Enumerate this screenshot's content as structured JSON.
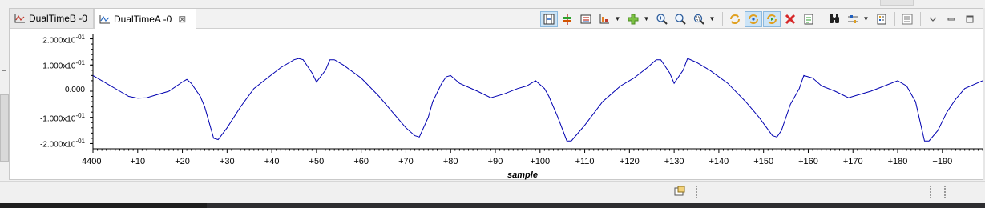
{
  "tabs": [
    {
      "label": "DualTimeB -0",
      "active": false
    },
    {
      "label": "DualTimeA -0",
      "active": true
    }
  ],
  "tab_close_glyph": "⊠",
  "toolbar_icons": [
    "align-cursors-icon",
    "add-marker-icon",
    "measure-icon",
    "display-properties-icon",
    "zoom-in-icon",
    "zoom-out-icon",
    "zoom-region-icon",
    "refresh-icon",
    "auto-refresh-icon",
    "continuous-refresh-icon",
    "clear-graph-icon",
    "export-icon",
    "pin-icon",
    "data-settings-icon",
    "graph-properties-icon",
    "view-menu-icon"
  ],
  "chart_data": {
    "type": "line",
    "xlabel": "sample",
    "x_start_label": "4400",
    "x_ticks": [
      "+10",
      "+20",
      "+30",
      "+40",
      "+50",
      "+60",
      "+70",
      "+80",
      "+90",
      "+100",
      "+110",
      "+120",
      "+130",
      "+140",
      "+150",
      "+160",
      "+170",
      "+180",
      "+190"
    ],
    "y_ticks": [
      {
        "mant": "2.000x10",
        "exp": "-01"
      },
      {
        "mant": "1.000x10",
        "exp": "-01"
      },
      {
        "mant": "0.000",
        "exp": ""
      },
      {
        "mant": "-1.000x10",
        "exp": "-01"
      },
      {
        "mant": "-2.000x10",
        "exp": "-01"
      }
    ],
    "ylim": [
      -0.22,
      0.22
    ],
    "xlim": [
      0,
      199
    ],
    "line_color": "#0000b0",
    "series": [
      {
        "values": [
          [
            0,
            0.06
          ],
          [
            3,
            0.03
          ],
          [
            6,
            0.0
          ],
          [
            8,
            -0.02
          ],
          [
            10,
            -0.027
          ],
          [
            12,
            -0.025
          ],
          [
            14,
            -0.015
          ],
          [
            17,
            0.0
          ],
          [
            20,
            0.035
          ],
          [
            21,
            0.045
          ],
          [
            22,
            0.03
          ],
          [
            24,
            -0.02
          ],
          [
            25,
            -0.06
          ],
          [
            27,
            -0.18
          ],
          [
            28,
            -0.185
          ],
          [
            30,
            -0.14
          ],
          [
            33,
            -0.06
          ],
          [
            36,
            0.01
          ],
          [
            39,
            0.05
          ],
          [
            42,
            0.09
          ],
          [
            45,
            0.12
          ],
          [
            46,
            0.125
          ],
          [
            47,
            0.12
          ],
          [
            49,
            0.07
          ],
          [
            50,
            0.035
          ],
          [
            52,
            0.08
          ],
          [
            53,
            0.12
          ],
          [
            54,
            0.12
          ],
          [
            56,
            0.1
          ],
          [
            60,
            0.05
          ],
          [
            64,
            -0.02
          ],
          [
            67,
            -0.08
          ],
          [
            70,
            -0.14
          ],
          [
            72,
            -0.17
          ],
          [
            73,
            -0.175
          ],
          [
            75,
            -0.1
          ],
          [
            76,
            -0.04
          ],
          [
            78,
            0.03
          ],
          [
            79,
            0.055
          ],
          [
            80,
            0.06
          ],
          [
            82,
            0.03
          ],
          [
            86,
            0.0
          ],
          [
            89,
            -0.025
          ],
          [
            92,
            -0.01
          ],
          [
            95,
            0.01
          ],
          [
            97,
            0.02
          ],
          [
            99,
            0.04
          ],
          [
            101,
            0.01
          ],
          [
            102,
            -0.02
          ],
          [
            104,
            -0.1
          ],
          [
            106,
            -0.19
          ],
          [
            107,
            -0.19
          ],
          [
            110,
            -0.13
          ],
          [
            114,
            -0.04
          ],
          [
            118,
            0.02
          ],
          [
            121,
            0.05
          ],
          [
            124,
            0.09
          ],
          [
            126,
            0.12
          ],
          [
            127,
            0.12
          ],
          [
            129,
            0.07
          ],
          [
            130,
            0.03
          ],
          [
            132,
            0.08
          ],
          [
            133,
            0.125
          ],
          [
            135,
            0.11
          ],
          [
            138,
            0.08
          ],
          [
            142,
            0.03
          ],
          [
            146,
            -0.04
          ],
          [
            149,
            -0.1
          ],
          [
            152,
            -0.17
          ],
          [
            153,
            -0.175
          ],
          [
            154,
            -0.15
          ],
          [
            156,
            -0.05
          ],
          [
            158,
            0.01
          ],
          [
            159,
            0.06
          ],
          [
            161,
            0.05
          ],
          [
            163,
            0.02
          ],
          [
            166,
            0.0
          ],
          [
            169,
            -0.025
          ],
          [
            171,
            -0.015
          ],
          [
            174,
            0.0
          ],
          [
            177,
            0.02
          ],
          [
            180,
            0.04
          ],
          [
            182,
            0.02
          ],
          [
            184,
            -0.04
          ],
          [
            186,
            -0.19
          ],
          [
            187,
            -0.19
          ],
          [
            189,
            -0.15
          ],
          [
            191,
            -0.08
          ],
          [
            193,
            -0.03
          ],
          [
            195,
            0.01
          ],
          [
            197,
            0.025
          ],
          [
            199,
            0.04
          ]
        ]
      }
    ]
  }
}
